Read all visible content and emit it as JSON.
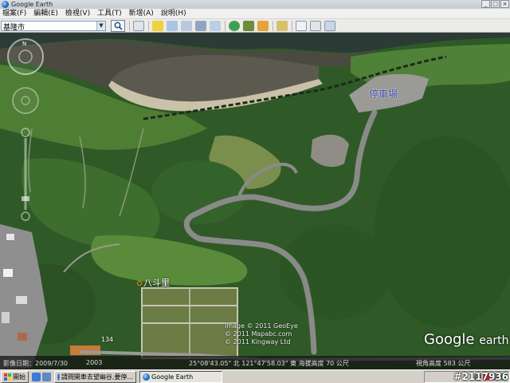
{
  "window": {
    "title": "Google Earth",
    "controls": [
      "_",
      "□",
      "×"
    ]
  },
  "menu": [
    "檔案(F)",
    "編輯(E)",
    "檢視(V)",
    "工具(T)",
    "新增(A)",
    "說明(H)"
  ],
  "search": {
    "value": "基隆市"
  },
  "map": {
    "parking_label": "停車場",
    "place_label": "八斗里",
    "road_number": "134",
    "credits": [
      "Image © 2011 GeoEye",
      "© 2011 Mapabc.com",
      "© 2011 Kingway Ltd"
    ],
    "logo_word1": "Google",
    "logo_word2": "earth",
    "colors": {
      "forest": "#2e5a26",
      "grass": "#5f8f3c",
      "road": "#8a8a8a",
      "rock": "#5a574c",
      "water": "#2c3b35"
    }
  },
  "status": {
    "imagery_date": "影像日期：2009/7/30",
    "year": "2003",
    "coords": "25°08'43.05\" 北 121°47'58.03\" 東 海拔高度 70 公尺",
    "eye_alt": "視角高度 583 公尺"
  },
  "taskbar": {
    "start_label": "開始",
    "tasks": [
      "請問開車去望幽谷,要停...",
      "Google Earth"
    ],
    "active_task": 1
  },
  "watermark": "#2117936"
}
